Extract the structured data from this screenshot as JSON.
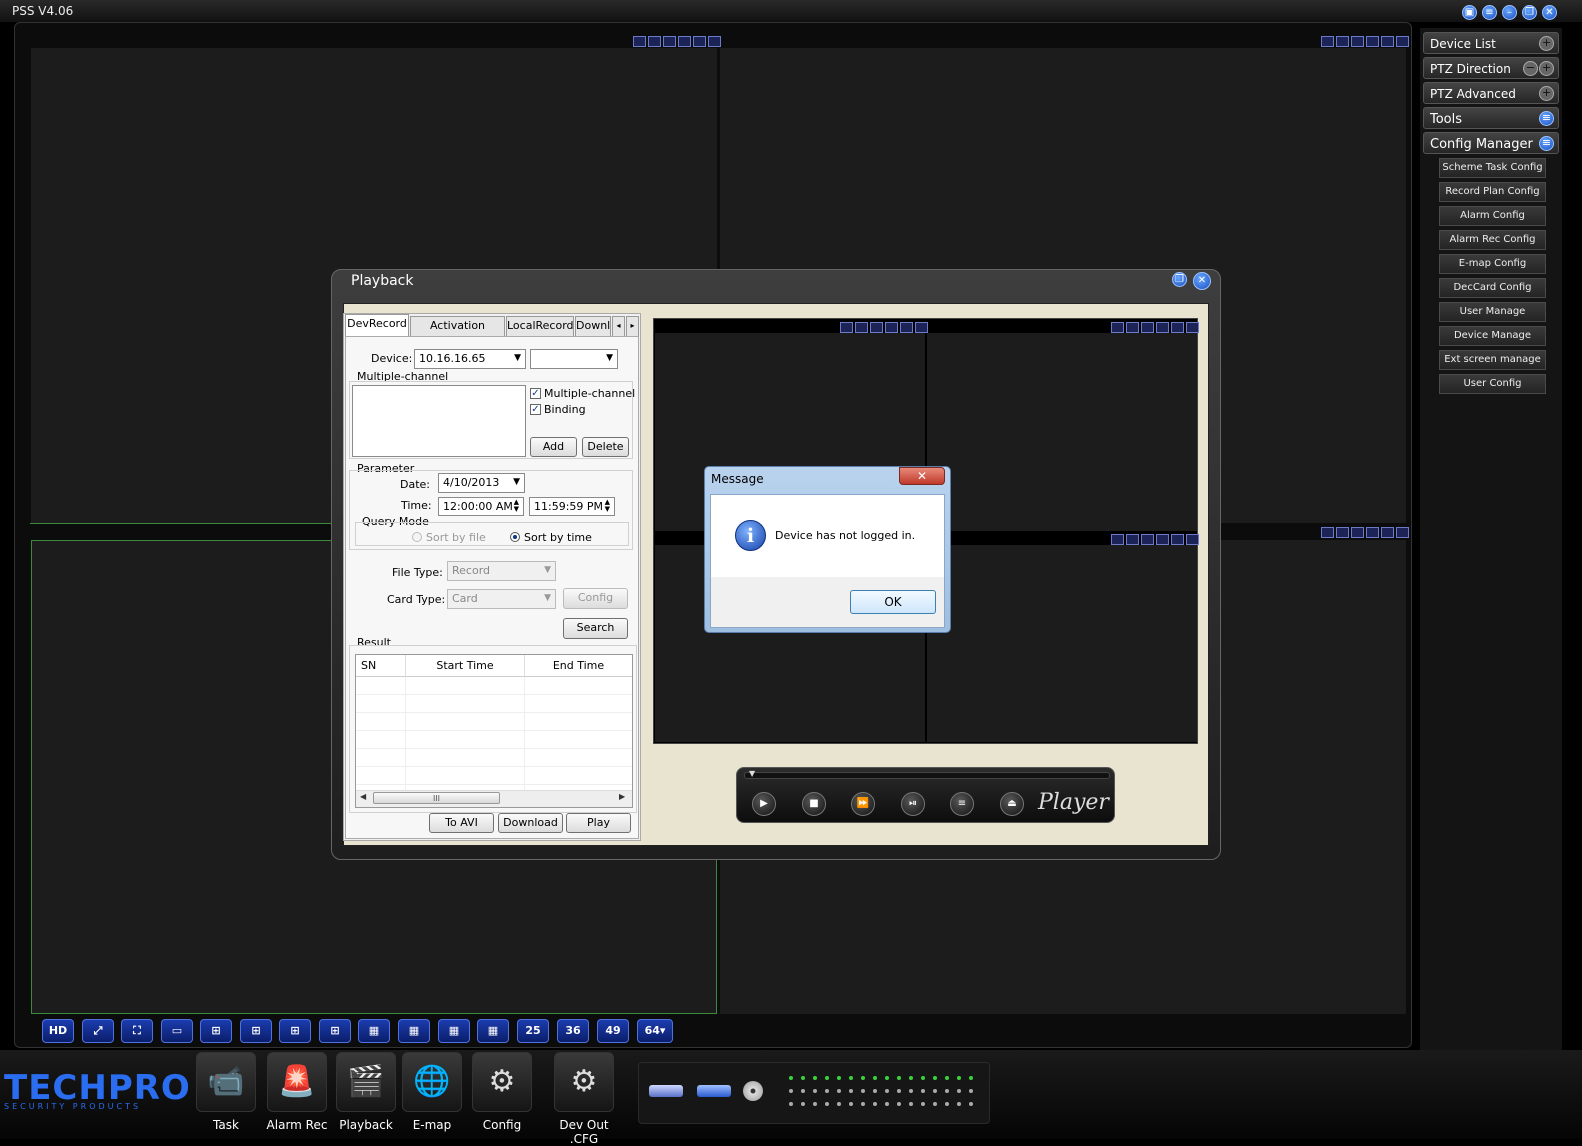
{
  "app": {
    "title": "PSS  V4.06"
  },
  "right_panel": {
    "headers": [
      {
        "label": "Device List"
      },
      {
        "label": "PTZ Direction"
      },
      {
        "label": "PTZ Advanced"
      },
      {
        "label": "Tools"
      },
      {
        "label": "Config Manager"
      }
    ],
    "config_items": [
      "Scheme Task Config",
      "Record Plan Config",
      "Alarm Config",
      "Alarm Rec Config",
      "E-map Config",
      "DecCard Config",
      "User Manage",
      "Device Manage",
      "Ext screen manage",
      "User Config"
    ]
  },
  "layout_toolbar": {
    "buttons": [
      "HD",
      "",
      "",
      "",
      "",
      "",
      "",
      "",
      "",
      "",
      "",
      "",
      "25",
      "36",
      "49",
      "64▾"
    ]
  },
  "logo": {
    "text": "TECHPRO",
    "subtext": "SECURITY PRODUCTS"
  },
  "bottom_toolbar": {
    "items": [
      {
        "label": "Task",
        "icon": "camera-icon"
      },
      {
        "label": "Alarm Rec",
        "icon": "alarm-icon"
      },
      {
        "label": "Playback",
        "icon": "clapperboard-icon"
      },
      {
        "label": "E-map",
        "icon": "globe-icon"
      },
      {
        "label": "Config",
        "icon": "config-icon"
      },
      {
        "label": "Dev Out .CFG",
        "icon": "device-out-icon"
      }
    ]
  },
  "playback": {
    "title": "Playback",
    "tabs": [
      "DevRecord",
      "Activation Record",
      "LocalRecord",
      "Downl"
    ],
    "active_tab": "DevRecord",
    "device_label": "Device:",
    "device_value": "10.16.16.65",
    "channel_value": "",
    "multichannel_group": "Multiple-channel",
    "multichannel_check": "Multiple-channel",
    "binding_check": "Binding",
    "add_button": "Add",
    "delete_button": "Delete",
    "parameter_group": "Parameter",
    "date_label": "Date:",
    "date_value": "4/10/2013",
    "time_label": "Time:",
    "time_start": "12:00:00 AM",
    "time_end": "11:59:59 PM",
    "query_mode_label": "Query Mode",
    "sort_by_file": "Sort by file",
    "sort_by_time": "Sort by time",
    "file_type_label": "File Type:",
    "file_type_value": "Record",
    "card_type_label": "Card Type:",
    "card_type_value": "Card",
    "config_button": "Config",
    "search_button": "Search",
    "result_label": "Result",
    "table_headers": [
      "SN",
      "Start Time",
      "End Time"
    ],
    "scroll_grip": "III",
    "to_avi_button": "To AVI",
    "download_button": "Download",
    "play_button": "Play",
    "player_logo": "Player"
  },
  "message": {
    "title": "Message",
    "close": "✕",
    "text": "Device has not logged in.",
    "ok": "OK"
  },
  "colors": {
    "accent_blue": "#1c3cae",
    "selected_cell_border": "#3c8a3c",
    "logo_blue": "#2a6df0"
  }
}
